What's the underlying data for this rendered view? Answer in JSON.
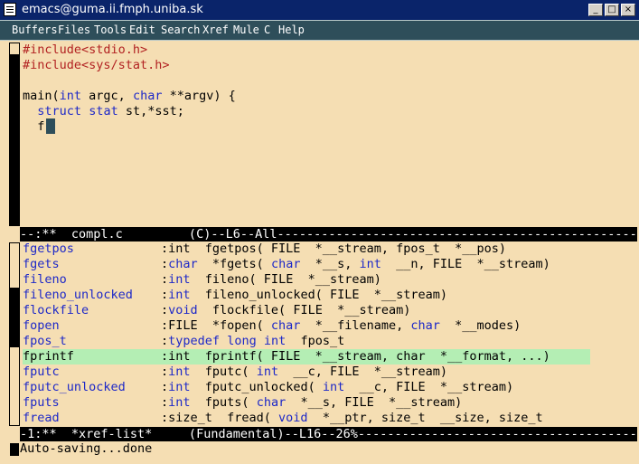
{
  "window": {
    "title": "emacs@guma.ii.fmph.uniba.sk",
    "buttons": [
      "_",
      "□",
      "×"
    ]
  },
  "menubar": [
    "Buffers",
    "Files",
    "Tools",
    "Edit",
    "Search",
    "Xref",
    "Mule",
    "C",
    "Help"
  ],
  "editor": {
    "lines": [
      [
        {
          "t": "#include<stdio.h>",
          "c": "pp"
        }
      ],
      [
        {
          "t": "#include<sys/stat.h>",
          "c": "pp"
        }
      ],
      [],
      [
        {
          "t": "main(",
          "c": ""
        },
        {
          "t": "int",
          "c": "kw"
        },
        {
          "t": " argc, ",
          "c": ""
        },
        {
          "t": "char",
          "c": "kw"
        },
        {
          "t": " **argv) {",
          "c": ""
        }
      ],
      [
        {
          "t": "  ",
          "c": ""
        },
        {
          "t": "struct",
          "c": "kw"
        },
        {
          "t": " ",
          "c": ""
        },
        {
          "t": "stat",
          "c": "kw"
        },
        {
          "t": " st,*sst;",
          "c": ""
        }
      ],
      [
        {
          "t": "  f",
          "c": ""
        }
      ]
    ],
    "modeline": "--:**  compl.c         (C)--L6--All----------------------------------------------------"
  },
  "xref": {
    "rows": [
      {
        "name": "fgetpos",
        "sig": [
          {
            "t": ":int  fgetpos( FILE  *__stream, fpos_t  *__pos)",
            "c": ""
          }
        ]
      },
      {
        "name": "fgets",
        "sig": [
          {
            "t": ":",
            "c": ""
          },
          {
            "t": "char",
            "c": "kw"
          },
          {
            "t": "  *fgets( ",
            "c": ""
          },
          {
            "t": "char",
            "c": "kw"
          },
          {
            "t": "  *__s, ",
            "c": ""
          },
          {
            "t": "int",
            "c": "kw"
          },
          {
            "t": "  __n, FILE  *__stream)",
            "c": ""
          }
        ]
      },
      {
        "name": "fileno",
        "sig": [
          {
            "t": ":",
            "c": ""
          },
          {
            "t": "int",
            "c": "kw"
          },
          {
            "t": "  fileno( FILE  *__stream)",
            "c": ""
          }
        ]
      },
      {
        "name": "fileno_unlocked",
        "sig": [
          {
            "t": ":",
            "c": ""
          },
          {
            "t": "int",
            "c": "kw"
          },
          {
            "t": "  fileno_unlocked( FILE  *__stream)",
            "c": ""
          }
        ]
      },
      {
        "name": "flockfile",
        "sig": [
          {
            "t": ":",
            "c": ""
          },
          {
            "t": "void",
            "c": "kw"
          },
          {
            "t": "  flockfile( FILE  *__stream)",
            "c": ""
          }
        ]
      },
      {
        "name": "fopen",
        "sig": [
          {
            "t": ":FILE  *fopen( ",
            "c": ""
          },
          {
            "t": "char",
            "c": "kw"
          },
          {
            "t": "  *__filename, ",
            "c": ""
          },
          {
            "t": "char",
            "c": "kw"
          },
          {
            "t": "  *__modes)",
            "c": ""
          }
        ]
      },
      {
        "name": "fpos_t",
        "sig": [
          {
            "t": ":",
            "c": ""
          },
          {
            "t": "typedef",
            "c": "kw"
          },
          {
            "t": " ",
            "c": ""
          },
          {
            "t": "long",
            "c": "kw"
          },
          {
            "t": " ",
            "c": ""
          },
          {
            "t": "int",
            "c": "kw"
          },
          {
            "t": "  fpos_t",
            "c": ""
          }
        ]
      },
      {
        "name": "fprintf",
        "sig": [
          {
            "t": ":int  fprintf( FILE  *__stream, char  *__format, ...)",
            "c": ""
          }
        ],
        "highlight": true
      },
      {
        "name": "fputc",
        "sig": [
          {
            "t": ":",
            "c": ""
          },
          {
            "t": "int",
            "c": "kw"
          },
          {
            "t": "  fputc( ",
            "c": ""
          },
          {
            "t": "int",
            "c": "kw"
          },
          {
            "t": "  __c, FILE  *__stream)",
            "c": ""
          }
        ]
      },
      {
        "name": "fputc_unlocked",
        "sig": [
          {
            "t": ":",
            "c": ""
          },
          {
            "t": "int",
            "c": "kw"
          },
          {
            "t": "  fputc_unlocked( ",
            "c": ""
          },
          {
            "t": "int",
            "c": "kw"
          },
          {
            "t": "  __c, FILE  *__stream)",
            "c": ""
          }
        ]
      },
      {
        "name": "fputs",
        "sig": [
          {
            "t": ":",
            "c": ""
          },
          {
            "t": "int",
            "c": "kw"
          },
          {
            "t": "  fputs( ",
            "c": ""
          },
          {
            "t": "char",
            "c": "kw"
          },
          {
            "t": "  *__s, FILE  *__stream)",
            "c": ""
          }
        ]
      },
      {
        "name": "fread",
        "sig": [
          {
            "t": ":size_t  fread( ",
            "c": ""
          },
          {
            "t": "void",
            "c": "kw"
          },
          {
            "t": "  *__ptr, size_t  __size, size_t",
            "c": ""
          }
        ]
      }
    ],
    "modeline": "-1:**  *xref-list*     (Fundamental)--L16--26%------------------------------------------"
  },
  "minibuffer": "Auto-saving...done",
  "colors": {
    "background": "#f5deb3",
    "keyword": "#1d28c8",
    "preprocessor": "#b22222",
    "highlight": "#b4eeb4",
    "menubar": "#2e4e5a",
    "titlebar": "#0a246a"
  }
}
